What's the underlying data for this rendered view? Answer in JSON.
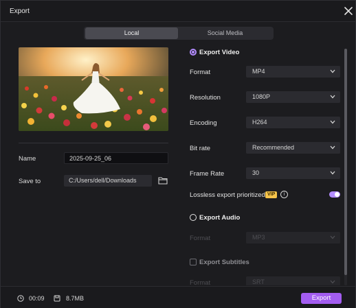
{
  "window": {
    "title": "Export"
  },
  "tabs": [
    {
      "label": "Local",
      "active": true
    },
    {
      "label": "Social Media",
      "active": false
    }
  ],
  "left": {
    "name_label": "Name",
    "name_value": "2025-09-25_06",
    "save_to_label": "Save to",
    "save_to_value": "C:/Users/dell/Downloads"
  },
  "video": {
    "title": "Export Video",
    "selected": true,
    "rows": [
      {
        "label": "Format",
        "value": "MP4"
      },
      {
        "label": "Resolution",
        "value": "1080P"
      },
      {
        "label": "Encoding",
        "value": "H264"
      },
      {
        "label": "Bit rate",
        "value": "Recommended"
      },
      {
        "label": "Frame Rate",
        "value": "30"
      }
    ],
    "lossless_label": "Lossless export prioritized",
    "vip_badge": "VIP",
    "info_glyph": "i",
    "lossless_on": true
  },
  "audio": {
    "title": "Export Audio",
    "selected": false,
    "format_label": "Format",
    "format_value": "MP3"
  },
  "subtitles": {
    "title": "Export Subtitles",
    "checked": false,
    "format_label": "Format",
    "format_value": "SRT"
  },
  "footer": {
    "duration": "00:09",
    "size": "8.7MB",
    "export_label": "Export"
  },
  "colors": {
    "accent": "#a35df0",
    "radio_accent": "#b38cff",
    "vip": "#f5c34a"
  },
  "icons": [
    "close-icon",
    "folder-icon",
    "chevron-down-icon",
    "info-icon",
    "clock-icon",
    "file-size-icon"
  ]
}
